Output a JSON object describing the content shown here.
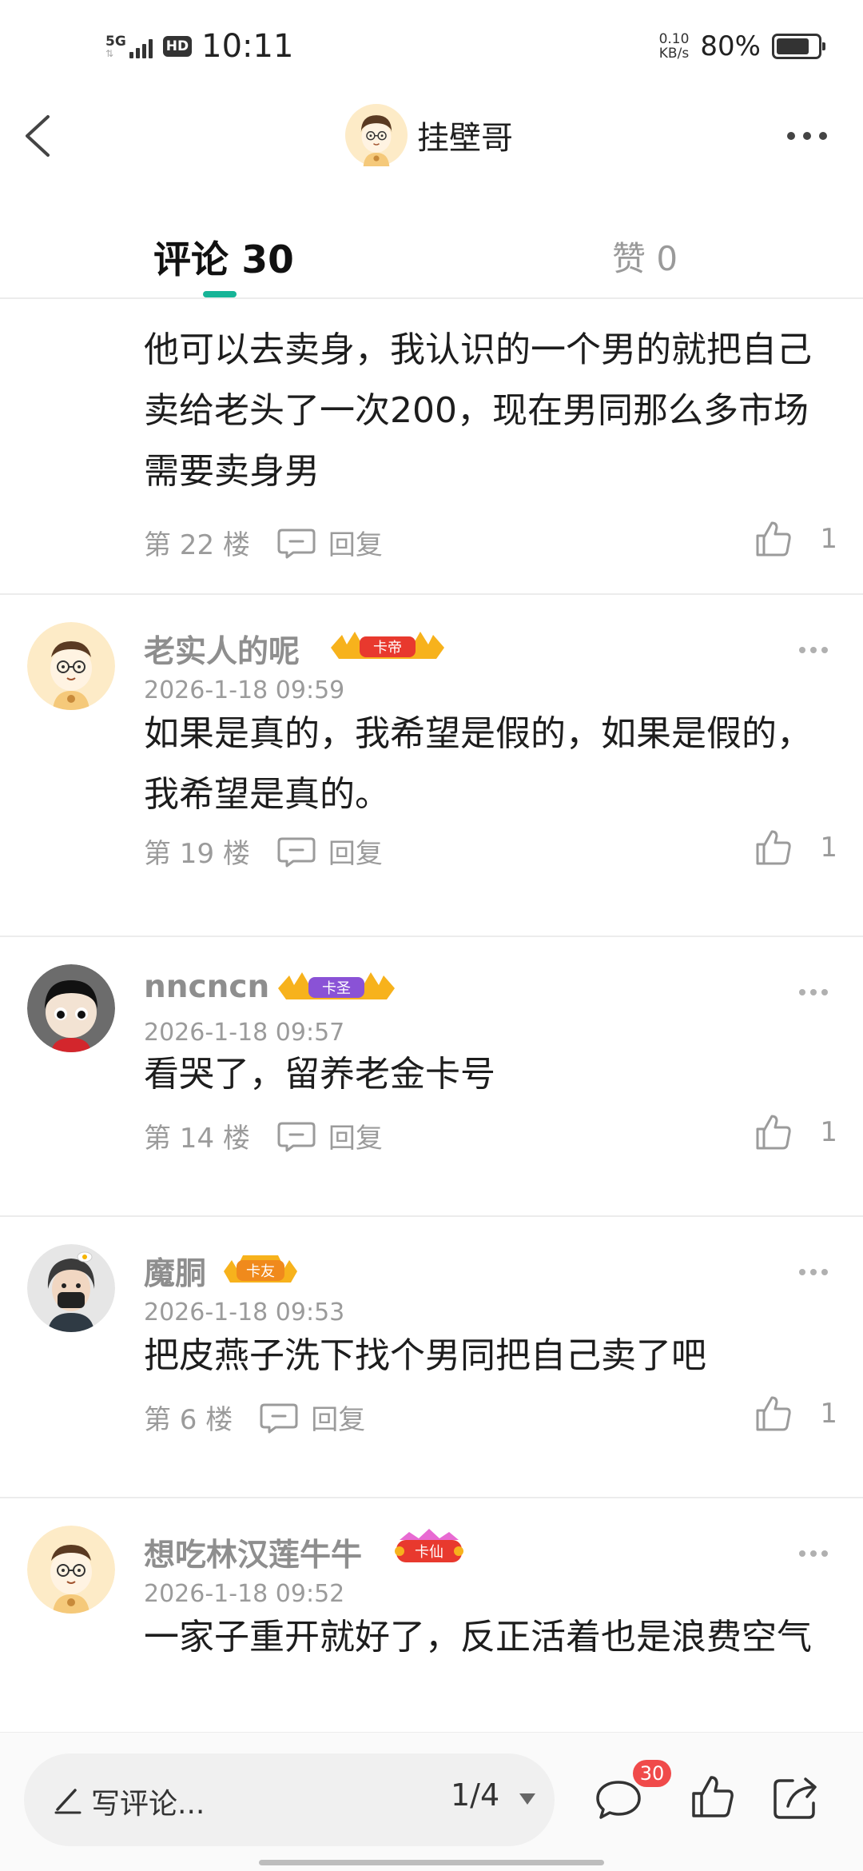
{
  "status_bar": {
    "network": "5G",
    "hd": "HD",
    "time": "10:11",
    "speed_value": "0.10",
    "speed_unit": "KB/s",
    "battery": "80%",
    "battery_level": 0.8
  },
  "header": {
    "title": "挂壁哥",
    "back_icon": "chevron-left-icon",
    "more_icon": "more-horizontal-icon"
  },
  "tabs": {
    "comments": "评论 30",
    "likes": "赞 0",
    "accent_color": "#17b497"
  },
  "comments": [
    {
      "text": "他可以去卖身，我认识的一个男的就把自己卖给老头了一次200，现在男同那么多市场需要卖身男",
      "floor": "第 22 楼",
      "reply_label": "回复",
      "likes": "1"
    },
    {
      "name": "老实人的呢",
      "badge": "卡帝",
      "time": "2026-1-18 09:59",
      "text": "如果是真的，我希望是假的，如果是假的，我希望是真的。",
      "floor": "第 19 楼",
      "reply_label": "回复",
      "likes": "1"
    },
    {
      "name": "nncncn",
      "badge": "卡圣",
      "time": "2026-1-18 09:57",
      "text": "看哭了，留养老金卡号",
      "floor": "第 14 楼",
      "reply_label": "回复",
      "likes": "1"
    },
    {
      "name": "魔胴",
      "badge": "卡友",
      "time": "2026-1-18 09:53",
      "text": "把皮燕子洗下找个男同把自己卖了吧",
      "floor": "第 6 楼",
      "reply_label": "回复",
      "likes": "1"
    },
    {
      "name": "想吃林汉莲牛牛",
      "badge": "卡仙",
      "time": "2026-1-18 09:52",
      "text": "一家子重开就好了，反正活着也是浪费空气"
    }
  ],
  "bottom_bar": {
    "write_placeholder": "写评论...",
    "page_indicator": "1/4",
    "comment_count_badge": "30",
    "badge_color": "#f04a4a"
  }
}
